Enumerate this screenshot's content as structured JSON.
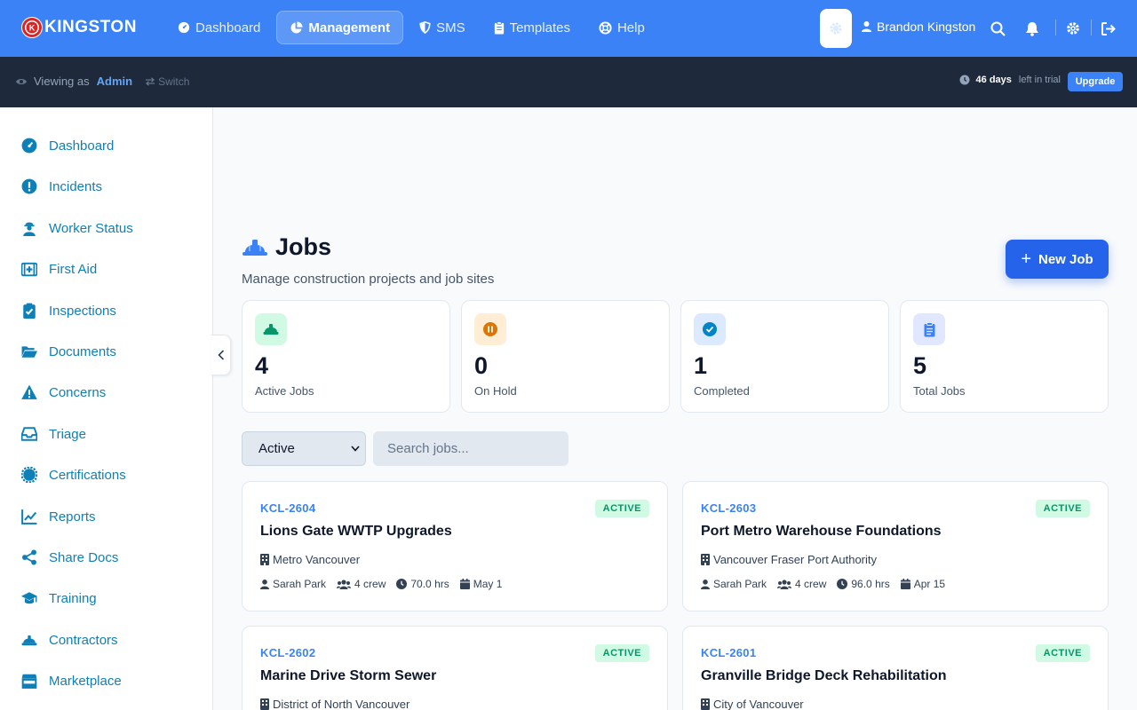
{
  "brand": {
    "name": "KINGSTON",
    "accent": "#3b82f6",
    "dark": "#1e293b"
  },
  "topnav": [
    {
      "label": "Dashboard",
      "icon": "gauge-icon",
      "active": false
    },
    {
      "label": "Management",
      "icon": "chart-pie-icon",
      "active": true
    },
    {
      "label": "SMS",
      "icon": "shield-icon",
      "active": false
    },
    {
      "label": "Templates",
      "icon": "clipboard-icon",
      "active": false
    },
    {
      "label": "Help",
      "icon": "lifebuoy-icon",
      "active": false
    }
  ],
  "user": {
    "name": "Brandon Kingston"
  },
  "viewing": {
    "prefix": "Viewing as",
    "role": "Admin",
    "switch": "Switch"
  },
  "trial": {
    "days": "46 days",
    "suffix": "left in trial",
    "upgrade": "Upgrade"
  },
  "sidebar": {
    "items": [
      {
        "label": "Dashboard",
        "icon": "gauge-icon"
      },
      {
        "label": "Incidents",
        "icon": "exclamation-circle-icon"
      },
      {
        "label": "Worker Status",
        "icon": "worker-icon"
      },
      {
        "label": "First Aid",
        "icon": "first-aid-kit-icon"
      },
      {
        "label": "Inspections",
        "icon": "clipboard-check-icon"
      },
      {
        "label": "Documents",
        "icon": "folder-open-icon"
      },
      {
        "label": "Concerns",
        "icon": "warning-triangle-icon"
      },
      {
        "label": "Triage",
        "icon": "inbox-icon"
      },
      {
        "label": "Certifications",
        "icon": "certificate-icon"
      },
      {
        "label": "Reports",
        "icon": "line-chart-icon"
      },
      {
        "label": "Share Docs",
        "icon": "share-icon"
      },
      {
        "label": "Training",
        "icon": "graduation-cap-icon"
      },
      {
        "label": "Contractors",
        "icon": "hard-hat-icon"
      },
      {
        "label": "Marketplace",
        "icon": "store-icon"
      }
    ]
  },
  "page": {
    "title": "Jobs",
    "subtitle": "Manage construction projects and job sites",
    "new_button": "New Job"
  },
  "stats": [
    {
      "value": "4",
      "label": "Active Jobs",
      "icon": "hard-hat-icon",
      "bg": "#d1fae5",
      "fg": "#059669"
    },
    {
      "value": "0",
      "label": "On Hold",
      "icon": "pause-icon",
      "bg": "#ffedd5",
      "fg": "#d97706"
    },
    {
      "value": "1",
      "label": "Completed",
      "icon": "check-circle-icon",
      "bg": "#dbeafe",
      "fg": "#0284c7"
    },
    {
      "value": "5",
      "label": "Total Jobs",
      "icon": "clipboard-list-icon",
      "bg": "#e0e7ff",
      "fg": "#3b82f6"
    }
  ],
  "filters": {
    "status": "Active",
    "search_placeholder": "Search jobs..."
  },
  "jobs": [
    {
      "code": "KCL-2604",
      "status": "ACTIVE",
      "title": "Lions Gate WWTP Upgrades",
      "org": "Metro Vancouver",
      "manager": "Sarah Park",
      "crew": "4 crew",
      "hours": "70.0 hrs",
      "date": "May 1"
    },
    {
      "code": "KCL-2603",
      "status": "ACTIVE",
      "title": "Port Metro Warehouse Foundations",
      "org": "Vancouver Fraser Port Authority",
      "manager": "Sarah Park",
      "crew": "4 crew",
      "hours": "96.0 hrs",
      "date": "Apr 15"
    },
    {
      "code": "KCL-2602",
      "status": "ACTIVE",
      "title": "Marine Drive Storm Sewer",
      "org": "District of North Vancouver",
      "manager": "",
      "crew": "",
      "hours": "",
      "date": ""
    },
    {
      "code": "KCL-2601",
      "status": "ACTIVE",
      "title": "Granville Bridge Deck Rehabilitation",
      "org": "City of Vancouver",
      "manager": "",
      "crew": "",
      "hours": "",
      "date": ""
    }
  ]
}
